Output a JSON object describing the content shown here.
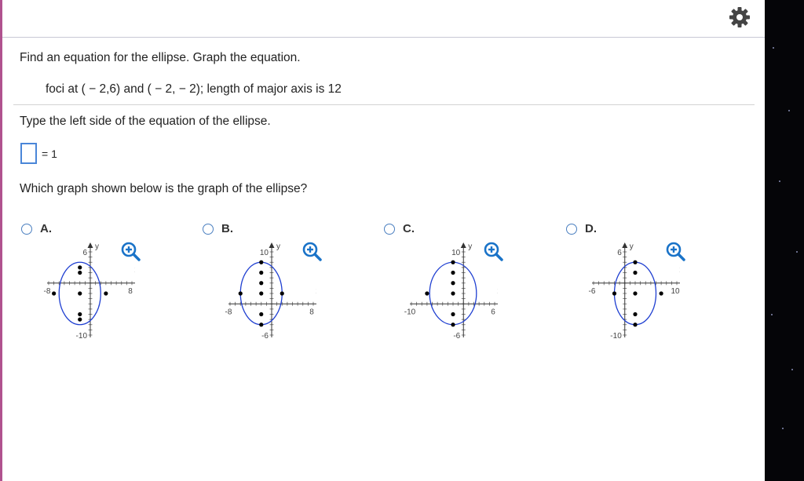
{
  "question": {
    "instruction": "Find an equation for the ellipse. Graph the equation.",
    "given": "foci at ( − 2,6) and ( − 2, − 2); length of major axis is 12",
    "part1_prompt": "Type the left side of the equation of the ellipse.",
    "equals": "= 1",
    "part2_prompt": "Which graph shown below is the graph of the ellipse?"
  },
  "options": [
    {
      "label": "A.",
      "graph": {
        "xmin": -8,
        "xmax": 8,
        "ymin": -10,
        "ymax": 6,
        "xmin_label": "-8",
        "xmax_label": "8",
        "ytop_label": "6",
        "ybot_label": "-10",
        "center": [
          -2,
          -2
        ],
        "rx": 4,
        "ry": 6,
        "points": [
          [
            -2,
            2
          ],
          [
            -2,
            -2
          ],
          [
            -2,
            -6
          ],
          [
            -7,
            -2
          ],
          [
            3,
            -2
          ],
          [
            -2,
            3
          ],
          [
            -2,
            -7
          ]
        ],
        "xaxis_letter": "x",
        "yaxis_letter": "y"
      }
    },
    {
      "label": "B.",
      "graph": {
        "xmin": -8,
        "xmax": 8,
        "ymin": -6,
        "ymax": 10,
        "xmin_label": "-8",
        "xmax_label": "8",
        "ytop_label": "10",
        "ybot_label": "-6",
        "center": [
          -2,
          2
        ],
        "rx": 4,
        "ry": 6,
        "points": [
          [
            -2,
            2
          ],
          [
            -2,
            6
          ],
          [
            -2,
            -2
          ],
          [
            -6,
            2
          ],
          [
            2,
            2
          ],
          [
            -2,
            8
          ],
          [
            -2,
            -4
          ],
          [
            -2,
            4
          ]
        ],
        "xaxis_letter": "x",
        "yaxis_letter": "y"
      }
    },
    {
      "label": "C.",
      "graph": {
        "xmin": -10,
        "xmax": 6,
        "ymin": -6,
        "ymax": 10,
        "xmin_label": "-10",
        "xmax_label": "6",
        "ytop_label": "10",
        "ybot_label": "-6",
        "center": [
          -2,
          2
        ],
        "rx": 4.5,
        "ry": 6,
        "points": [
          [
            -2,
            8
          ],
          [
            -2,
            6
          ],
          [
            -2,
            2
          ],
          [
            -2,
            -2
          ],
          [
            -2,
            -4
          ],
          [
            -7,
            2
          ],
          [
            -2,
            4
          ]
        ],
        "xaxis_letter": "x",
        "yaxis_letter": "y"
      }
    },
    {
      "label": "D.",
      "graph": {
        "xmin": -6,
        "xmax": 10,
        "ymin": -10,
        "ymax": 6,
        "xmin_label": "-6",
        "xmax_label": "10",
        "ytop_label": "6",
        "ybot_label": "-10",
        "center": [
          2,
          -2
        ],
        "rx": 4,
        "ry": 6,
        "points": [
          [
            2,
            4
          ],
          [
            2,
            2
          ],
          [
            2,
            -2
          ],
          [
            2,
            -6
          ],
          [
            2,
            -8
          ],
          [
            -2,
            -2
          ],
          [
            7,
            -2
          ]
        ],
        "xaxis_letter": "x",
        "yaxis_letter": "y"
      }
    }
  ],
  "icons": {
    "settings": "gear-icon",
    "zoom": "zoom-in-icon"
  },
  "colors": {
    "ellipse": "#1f3fd1",
    "zoom": "#1a73c8",
    "radio": "#4a7fc0",
    "answer_box": "#4a86d8"
  }
}
